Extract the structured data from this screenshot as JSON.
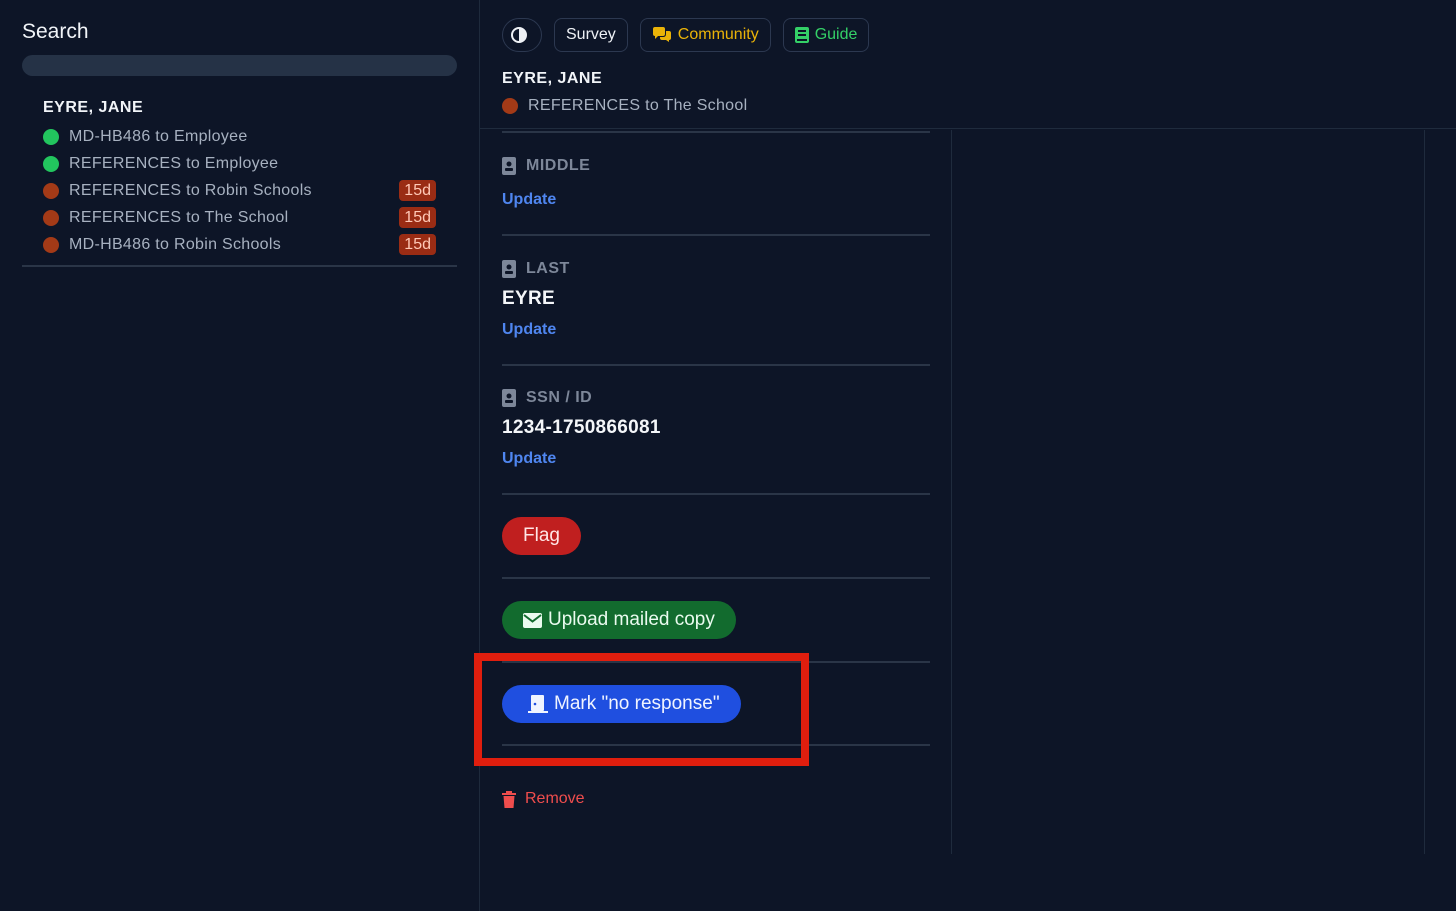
{
  "sidebar": {
    "search_title": "Search",
    "search_value": "",
    "person_name": "EYRE, JANE",
    "requests": [
      {
        "label": "MD-HB486 to Employee",
        "status_color": "#22c55e",
        "badge": ""
      },
      {
        "label": "REFERENCES to Employee",
        "status_color": "#22c55e",
        "badge": ""
      },
      {
        "label": "REFERENCES to Robin Schools",
        "status_color": "#a33a17",
        "badge": "15d"
      },
      {
        "label": "REFERENCES to The School",
        "status_color": "#a33a17",
        "badge": "15d"
      },
      {
        "label": "MD-HB486 to Robin Schools",
        "status_color": "#a33a17",
        "badge": "15d"
      }
    ]
  },
  "toolbar": {
    "theme_icon": "contrast-icon",
    "survey_label": "Survey",
    "community_label": "Community",
    "community_icon": "comments-icon",
    "guide_label": "Guide",
    "guide_icon": "book-icon"
  },
  "header": {
    "name": "EYRE, JANE",
    "request_label": "REFERENCES to The School",
    "request_status_color": "#a33a17"
  },
  "fields": {
    "middle": {
      "label": "MIDDLE",
      "value": "",
      "update_label": "Update"
    },
    "last": {
      "label": "LAST",
      "value": "EYRE",
      "update_label": "Update"
    },
    "ssn": {
      "label": "SSN / ID",
      "value": "1234-1750866081",
      "update_label": "Update"
    }
  },
  "actions": {
    "flag_label": "Flag",
    "upload_label": "Upload mailed copy",
    "no_response_label": "Mark \"no response\"",
    "remove_label": "Remove"
  },
  "colors": {
    "background": "#0d1527",
    "accent_link": "#4f86f0",
    "highlight": "#e01e0e"
  }
}
